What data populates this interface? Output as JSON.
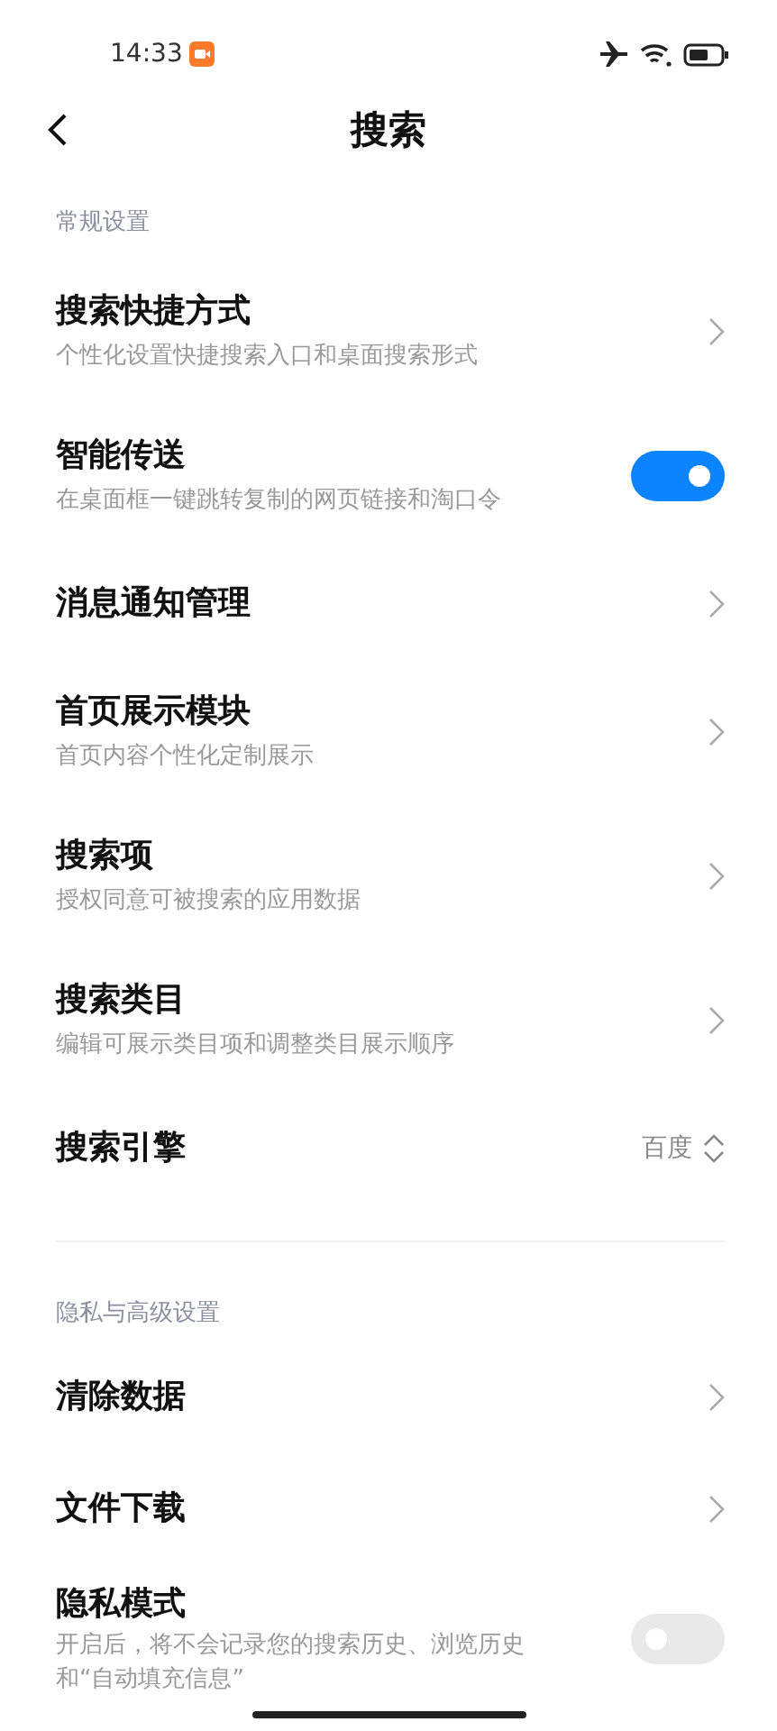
{
  "status_bar": {
    "time": "14:33"
  },
  "header": {
    "title": "搜索"
  },
  "sections": [
    {
      "title": "常规设置",
      "items": [
        {
          "kind": "link",
          "title": "搜索快捷方式",
          "subtitle": "个性化设置快捷搜索入口和桌面搜索形式"
        },
        {
          "kind": "toggle",
          "title": "智能传送",
          "subtitle": "在桌面框一键跳转复制的网页链接和淘口令",
          "on": true
        },
        {
          "kind": "link",
          "title": "消息通知管理"
        },
        {
          "kind": "link",
          "title": "首页展示模块",
          "subtitle": "首页内容个性化定制展示"
        },
        {
          "kind": "link",
          "title": "搜索项",
          "subtitle": "授权同意可被搜索的应用数据"
        },
        {
          "kind": "link",
          "title": "搜索类目",
          "subtitle": "编辑可展示类目项和调整类目展示顺序"
        },
        {
          "kind": "select",
          "title": "搜索引擎",
          "value": "百度"
        }
      ]
    },
    {
      "title": "隐私与高级设置",
      "items": [
        {
          "kind": "link",
          "title": "清除数据"
        },
        {
          "kind": "link",
          "title": "文件下载"
        },
        {
          "kind": "toggle",
          "title": "隐私模式",
          "subtitle": "开启后，将不会记录您的搜索历史、浏览历史和“自动填充信息”",
          "on": false
        }
      ]
    }
  ]
}
